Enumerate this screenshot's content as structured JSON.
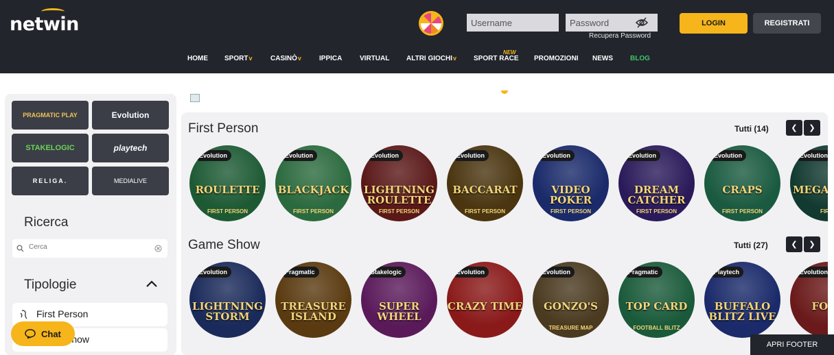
{
  "header": {
    "logo": "netwin",
    "username_placeholder": "Username",
    "password_placeholder": "Password",
    "recover": "Recupera Password",
    "login": "LOGIN",
    "register": "REGISTRATI"
  },
  "nav": {
    "home": "HOME",
    "sport": "SPORT",
    "casino": "CASINÒ",
    "ippica": "IPPICA",
    "virtual": "VIRTUAL",
    "altri": "ALTRI GIOCHI",
    "sportrace": "SPORT RACE",
    "new_badge": "NEW",
    "promozioni": "PROMOZIONI",
    "news": "NEWS",
    "blog": "BLOG"
  },
  "providers": [
    "PRAGMATIC PLAY",
    "Evolution",
    "STAKELOGIC",
    "playtech",
    "RELIGA.",
    "MEDIALIVE"
  ],
  "sidebar": {
    "ricerca": "Ricerca",
    "search_placeholder": "Cerca",
    "tipologie": "Tipologie",
    "types": [
      "First Person",
      "Game Show"
    ]
  },
  "sections": [
    {
      "title": "First Person",
      "tutti": "Tutti (14)",
      "games": [
        {
          "provider": "Evolution",
          "title": "ROULETTE",
          "sub": "FIRST PERSON",
          "color": "#1d5a34"
        },
        {
          "provider": "Evolution",
          "title": "BLACKJACK",
          "sub": "FIRST PERSON",
          "color": "#2b6a3e"
        },
        {
          "provider": "Evolution",
          "title": "LIGHTNING ROULETTE",
          "sub": "FIRST PERSON",
          "color": "#5a1818"
        },
        {
          "provider": "Evolution",
          "title": "BACCARAT",
          "sub": "FIRST PERSON",
          "color": "#4a3510"
        },
        {
          "provider": "Evolution",
          "title": "VIDEO POKER",
          "sub": "FIRST PERSON",
          "color": "#1a2a6a"
        },
        {
          "provider": "Evolution",
          "title": "DREAM CATCHER",
          "sub": "FIRST PERSON",
          "color": "#2a1a5a"
        },
        {
          "provider": "Evolution",
          "title": "CRAPS",
          "sub": "FIRST PERSON",
          "color": "#1a5a40"
        },
        {
          "provider": "Evolution",
          "title": "MEGA BALL",
          "sub": "FIRST",
          "color": "#123a30"
        }
      ]
    },
    {
      "title": "Game Show",
      "tutti": "Tutti (27)",
      "games": [
        {
          "provider": "Evolution",
          "title": "LIGHTNING STORM",
          "sub": "",
          "color": "#1a2a5a"
        },
        {
          "provider": "Pragmatic",
          "title": "TREASURE ISLAND",
          "sub": "",
          "color": "#5a3a10"
        },
        {
          "provider": "Stakelogic",
          "title": "SUPER WHEEL",
          "sub": "",
          "color": "#5a1a5a"
        },
        {
          "provider": "Evolution",
          "title": "CRAZY TIME",
          "sub": "",
          "color": "#8a1a1a"
        },
        {
          "provider": "Evolution",
          "title": "GONZO'S",
          "sub": "TREASURE MAP",
          "color": "#4a3a20"
        },
        {
          "provider": "Pragmatic",
          "title": "TOP CARD",
          "sub": "FOOTBALL BLITZ",
          "color": "#1a5a3a"
        },
        {
          "provider": "Playtech",
          "title": "BUFFALO BLITZ LIVE",
          "sub": "",
          "color": "#1a2a6a"
        },
        {
          "provider": "Evolution",
          "title": "FOOT",
          "sub": "",
          "color": "#6a1a1a"
        }
      ]
    }
  ],
  "chat": "Chat",
  "footer": "APRI FOOTER"
}
